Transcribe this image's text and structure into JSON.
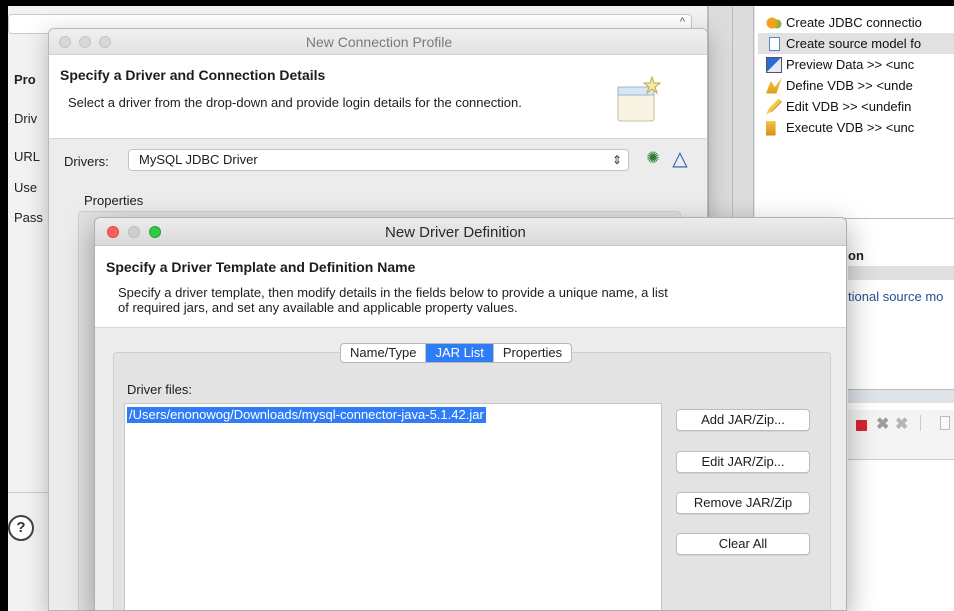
{
  "background": {
    "left_labels": [
      "Pro",
      "Driv",
      "URL",
      "Use",
      "Pass"
    ],
    "help_icon": "question-icon",
    "right_list": [
      {
        "icon": "jdbc-connection-icon",
        "label": "Create JDBC connectio"
      },
      {
        "icon": "source-model-icon",
        "label": "Create source model fo",
        "selected": true
      },
      {
        "icon": "preview-data-icon",
        "label": "Preview Data >>   <unc"
      },
      {
        "icon": "define-vdb-icon",
        "label": "Define VDB >>   <unde"
      },
      {
        "icon": "edit-vdb-icon",
        "label": "Edit VDB >>   <undefin"
      },
      {
        "icon": "execute-vdb-icon",
        "label": "Execute VDB >>   <unc"
      }
    ],
    "right_section_label": "on",
    "right_link_text": "tional source mo"
  },
  "connection_profile": {
    "title": "New Connection Profile",
    "header_title": "Specify a Driver and Connection Details",
    "header_desc": "Select a driver from the drop-down and provide login details for the connection.",
    "drivers_label": "Drivers:",
    "drivers_value": "MySQL JDBC Driver",
    "properties_label": "Properties"
  },
  "driver_definition": {
    "title": "New Driver Definition",
    "header_title": "Specify a Driver Template and Definition Name",
    "header_desc_line1": "Specify a driver template, then modify details in the fields below to provide a unique name, a list",
    "header_desc_line2": "of required jars, and set any available and applicable property values.",
    "tabs": [
      "Name/Type",
      "JAR List",
      "Properties"
    ],
    "active_tab": "JAR List",
    "driver_files_label": "Driver files:",
    "driver_files": [
      "/Users/enonowog/Downloads/mysql-connector-java-5.1.42.jar"
    ],
    "buttons": {
      "add": "Add JAR/Zip...",
      "edit": "Edit JAR/Zip...",
      "remove": "Remove JAR/Zip",
      "clear": "Clear All"
    }
  },
  "colors": {
    "accent": "#2f7cf6",
    "close": "#fc605c",
    "zoom": "#34c84a",
    "stop": "#d9232e"
  }
}
